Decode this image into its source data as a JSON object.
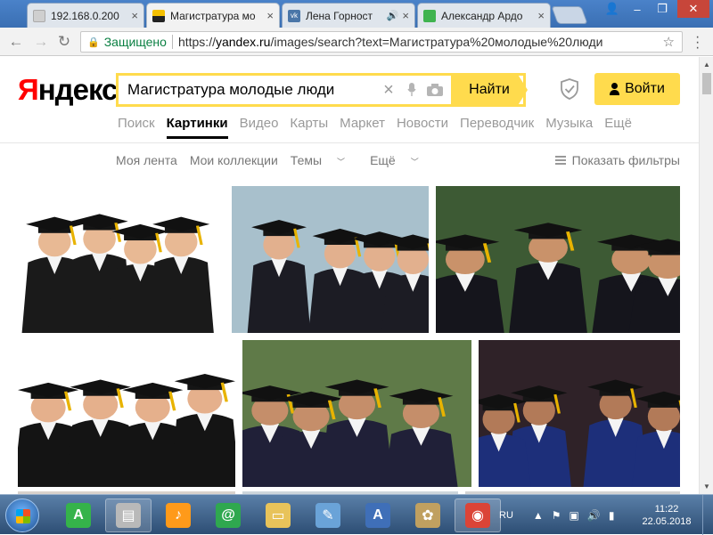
{
  "browser": {
    "tabs": [
      {
        "label": "192.168.0.200",
        "favicon_color": "#cfcfcf",
        "active": false
      },
      {
        "label": "Магистратура мо",
        "favicon_color": "#f5c000",
        "active": true
      },
      {
        "label": "Лена Горност",
        "favicon_color": "#4a76a8",
        "active": false,
        "audio": "🔊"
      },
      {
        "label": "Александр Ардо",
        "favicon_color": "#3fb34f",
        "active": false
      }
    ],
    "close_glyph": "×",
    "window_controls": {
      "user": "👤",
      "minimize": "–",
      "restore": "❐",
      "close": "✕"
    },
    "secure_label": "Защищено",
    "url_scheme": "https://",
    "url_host": "yandex.ru",
    "url_path": "/images/search?text=Магистратура%20молодые%20люди"
  },
  "yandex": {
    "logo_first": "Я",
    "logo_rest": "ндекс",
    "query": "Магистратура молодые люди",
    "find_label": "Найти",
    "login_label": "Войти",
    "services": [
      "Поиск",
      "Картинки",
      "Видео",
      "Карты",
      "Маркет",
      "Новости",
      "Переводчик",
      "Музыка",
      "Ещё"
    ],
    "active_service": "Картинки",
    "subnav": {
      "feed": "Моя лента",
      "collections": "Мои коллекции",
      "topics": "Темы",
      "more": "Ещё",
      "filters": "Показать фильтры"
    }
  },
  "images": [
    {
      "name": "graduates-group-1",
      "sky": "#ffffff",
      "skin": "#e8b994",
      "gown": "#1a1a1a"
    },
    {
      "name": "graduates-group-2",
      "sky": "#a8c0cc",
      "skin": "#e2b08e",
      "gown": "#1c1c24"
    },
    {
      "name": "graduates-group-3",
      "sky": "#3d5a34",
      "skin": "#c9926a",
      "gown": "#15151c"
    },
    {
      "name": "graduates-group-4",
      "sky": "#ffffff",
      "skin": "#e5b08c",
      "gown": "#141414"
    },
    {
      "name": "graduates-group-5",
      "sky": "#5f7a48",
      "skin": "#c58e6a",
      "gown": "#202038"
    },
    {
      "name": "graduates-group-6",
      "sky": "#2f2228",
      "skin": "#b27a58",
      "gown": "#1d2f7a"
    }
  ],
  "taskbar": {
    "apps": [
      {
        "name": "launcher-app",
        "glyph": "A",
        "color": "#35b34a"
      },
      {
        "name": "notes-app",
        "glyph": "▤",
        "color": "#b9b9b9",
        "running": true
      },
      {
        "name": "music-app",
        "glyph": "♪",
        "color": "#ff9a1a"
      },
      {
        "name": "mail-app",
        "glyph": "@",
        "color": "#2fa84f"
      },
      {
        "name": "explorer-app",
        "glyph": "▭",
        "color": "#e8c35a"
      },
      {
        "name": "notepad-app",
        "glyph": "✎",
        "color": "#6aa3d8"
      },
      {
        "name": "wordpad-app",
        "glyph": "A",
        "color": "#3f6fb8"
      },
      {
        "name": "paint-app",
        "glyph": "✿",
        "color": "#c0a060"
      },
      {
        "name": "chrome-app",
        "glyph": "◉",
        "color": "#db4437",
        "running": true
      }
    ],
    "lang": "RU",
    "time": "11:22",
    "date": "22.05.2018"
  }
}
